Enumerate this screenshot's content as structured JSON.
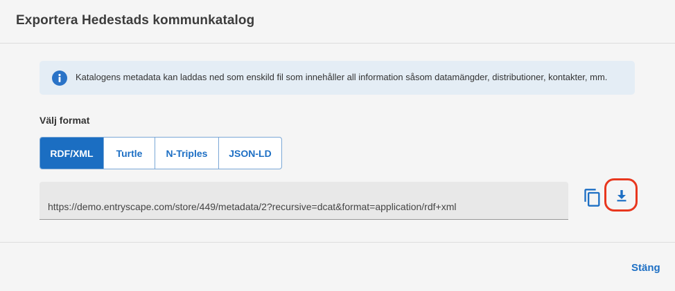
{
  "dialog": {
    "title": "Exportera Hedestads kommunkatalog",
    "info_text": "Katalogens metadata kan laddas ned som enskild fil som innehåller all information såsom datamängder, distributioner, kontakter, mm.",
    "info_icon": "info-icon"
  },
  "format": {
    "label": "Välj format",
    "options": [
      {
        "label": "RDF/XML",
        "active": true
      },
      {
        "label": "Turtle",
        "active": false
      },
      {
        "label": "N-Triples",
        "active": false
      },
      {
        "label": "JSON-LD",
        "active": false
      }
    ]
  },
  "url_field": {
    "value": "https://demo.entryscape.com/store/449/metadata/2?recursive=dcat&format=application/rdf+xml"
  },
  "actions": {
    "copy_icon": "copy-icon",
    "download_icon": "download-icon"
  },
  "footer": {
    "close_label": "Stäng"
  },
  "colors": {
    "accent": "#1b6ec2",
    "info_bg": "#e4edf5",
    "highlight": "#e8371e"
  }
}
